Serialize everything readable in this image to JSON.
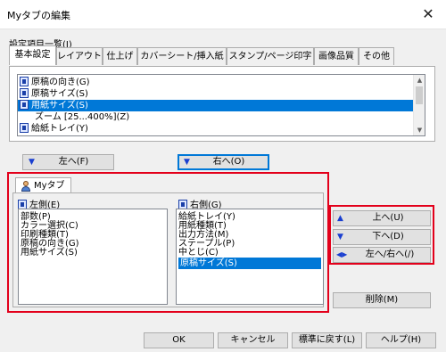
{
  "window": {
    "title": "Myタブの編集",
    "close_glyph": "✕"
  },
  "settings_label": "設定項目一覧(I)",
  "tabs": [
    {
      "label": "基本設定",
      "active": true
    },
    {
      "label": "レイアウト"
    },
    {
      "label": "仕上げ"
    },
    {
      "label": "カバーシート/挿入紙"
    },
    {
      "label": "スタンプ/ページ印字"
    },
    {
      "label": "画像品質"
    },
    {
      "label": "その他"
    }
  ],
  "settings_list": [
    {
      "label": "原稿の向き(G)",
      "icon": true
    },
    {
      "label": "原稿サイズ(S)",
      "icon": true
    },
    {
      "label": "用紙サイズ(S)",
      "icon": true,
      "selected": true
    },
    {
      "label": "ズーム [25...400%](Z)",
      "icon": false
    },
    {
      "label": "給紙トレイ(Y)",
      "icon": true
    }
  ],
  "buttons": {
    "left_to": "左へ(F)",
    "right_to": "右へ(O)",
    "up": "上へ(U)",
    "down": "下へ(D)",
    "left_right": "左へ/右へ(/)",
    "delete": "削除(M)",
    "ok": "OK",
    "cancel": "キャンセル",
    "reset": "標準に戻す(L)",
    "help": "ヘルプ(H)"
  },
  "mytab": {
    "tab_label": "Myタブ",
    "left_label": "左側(E)",
    "right_label": "右側(G)",
    "left_items": [
      "部数(P)",
      "カラー選択(C)",
      "印刷種類(T)",
      "原稿の向き(G)",
      "用紙サイズ(S)"
    ],
    "right_items": [
      "給紙トレイ(Y)",
      "用紙種類(T)",
      "出力方法(M)",
      "ステープル(P)",
      "中とじ(C)",
      "原稿サイズ(S)"
    ],
    "right_selected_index": 5
  },
  "colors": {
    "highlight": "#0078d7",
    "red_frame": "#e3001b",
    "arrow_blue": "#1a3fd0"
  }
}
